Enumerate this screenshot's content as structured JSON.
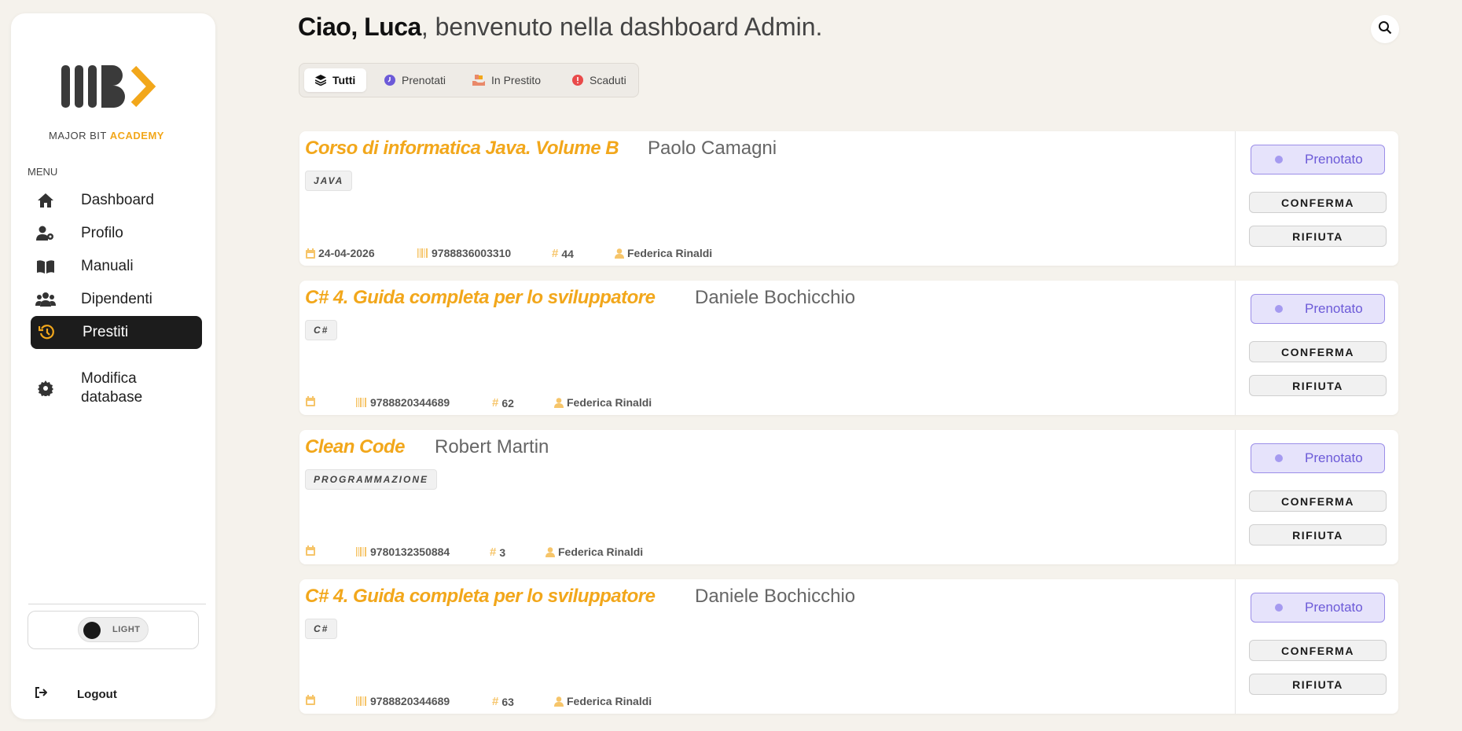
{
  "sidebar": {
    "logo": {
      "text_main": "MAJOR BIT",
      "text_accent": "ACADEMY"
    },
    "menu_title": "MENU",
    "items": [
      {
        "label": "Dashboard",
        "icon": "home-icon",
        "active": false
      },
      {
        "label": "Profilo",
        "icon": "user-gear-icon",
        "active": false
      },
      {
        "label": "Manuali",
        "icon": "book-icon",
        "active": false
      },
      {
        "label": "Dipendenti",
        "icon": "users-icon",
        "active": false
      },
      {
        "label": "Prestiti",
        "icon": "history-icon",
        "active": true
      },
      {
        "label": "Modifica database",
        "icon": "gear-icon",
        "active": false
      }
    ],
    "theme_toggle": {
      "label": "LIGHT"
    },
    "logout": {
      "label": "Logout",
      "icon": "logout-icon"
    }
  },
  "header": {
    "greeting_bold": "Ciao, Luca",
    "greeting_rest": ", benvenuto nella dashboard Admin."
  },
  "filters": [
    {
      "label": "Tutti",
      "icon": "layers-icon",
      "active": true
    },
    {
      "label": "Prenotati",
      "icon": "clock-icon",
      "active": false
    },
    {
      "label": "In Prestito",
      "icon": "hand-book-icon",
      "active": false
    },
    {
      "label": "Scaduti",
      "icon": "alert-icon",
      "active": false
    }
  ],
  "loans": [
    {
      "title": "Corso di informatica Java. Volume B",
      "author": "Paolo Camagni",
      "tag": "JAVA",
      "date": "24-04-2026",
      "isbn": "9788836003310",
      "number": "44",
      "user": "Federica Rinaldi",
      "status": "Prenotato"
    },
    {
      "title": "C# 4. Guida completa per lo sviluppatore",
      "author": "Daniele Bochicchio",
      "tag": "C#",
      "date": "",
      "isbn": "9788820344689",
      "number": "62",
      "user": "Federica Rinaldi",
      "status": "Prenotato"
    },
    {
      "title": "Clean Code",
      "author": "Robert Martin",
      "tag": "PROGRAMMAZIONE",
      "date": "",
      "isbn": "9780132350884",
      "number": "3",
      "user": "Federica Rinaldi",
      "status": "Prenotato"
    },
    {
      "title": "C# 4. Guida completa per lo sviluppatore",
      "author": "Daniele Bochicchio",
      "tag": "C#",
      "date": "",
      "isbn": "9788820344689",
      "number": "63",
      "user": "Federica Rinaldi",
      "status": "Prenotato"
    }
  ],
  "actions": {
    "confirm": "CONFERMA",
    "reject": "RIFIUTA"
  },
  "colors": {
    "accent": "#f2a71b",
    "status_purple": "#6c5ad8",
    "dark": "#1c1c1c"
  }
}
